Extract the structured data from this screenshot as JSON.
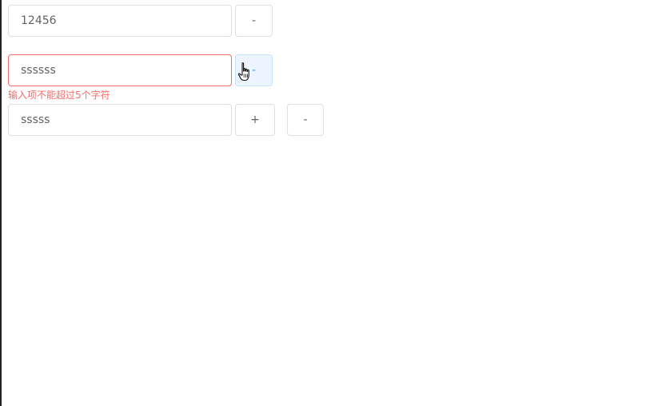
{
  "rows": [
    {
      "input_value": "12456",
      "buttons": [
        "-"
      ]
    },
    {
      "input_value": "ssssss",
      "input_state": "error",
      "buttons": [
        "-"
      ],
      "button_state": "hover",
      "error_message": "输入项不能超过5个字符"
    },
    {
      "input_value": "sssss",
      "buttons": [
        "+",
        "-"
      ]
    }
  ],
  "colors": {
    "error": "#f56c6c",
    "border": "#dcdfe6",
    "hover_bg": "#ecf5ff",
    "hover_border": "#c6e2ff",
    "text": "#606266"
  },
  "cursor_icon": "hand-pointer-icon"
}
